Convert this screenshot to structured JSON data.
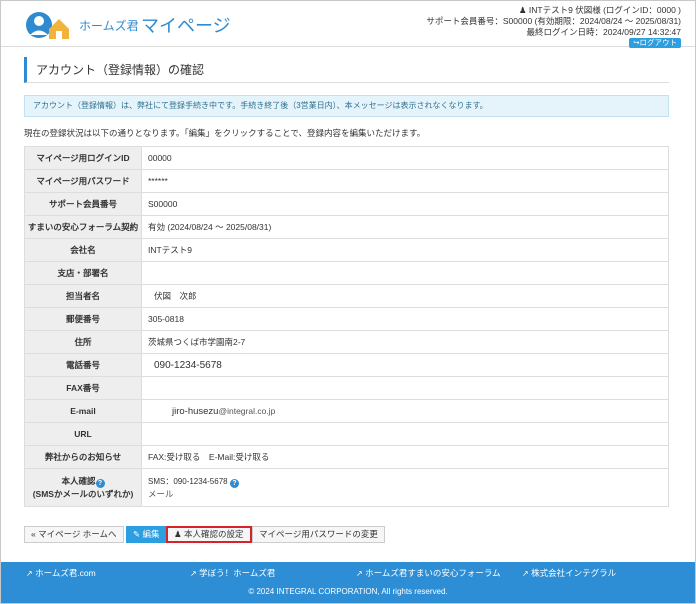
{
  "header": {
    "brand_small": "ホームズ君",
    "brand_large": "マイページ",
    "user_line": "INTテスト9  伏図様 (ログインID：0000  )",
    "member_line": "サポート会員番号：S00000  (有効期限：2024/08/24 ～ 2025/08/31)",
    "last_login": "最終ログイン日時：2024/09/27 14:32:47",
    "logout_label": "ログアウト"
  },
  "page": {
    "title": "アカウント（登録情報）の確認",
    "notice": "アカウント（登録情報）は、弊社にて登録手続き中です。手続き終了後（3営業日内）、本メッセージは表示されなくなります。",
    "intro": "現在の登録状況は以下の通りとなります。「編集」をクリックすることで、登録内容を編集いただけます。"
  },
  "rows": [
    {
      "label": "マイページ用ログインID",
      "value": "00000"
    },
    {
      "label": "マイページ用パスワード",
      "value": "******"
    },
    {
      "label": "サポート会員番号",
      "value": "S00000"
    },
    {
      "label": "すまいの安心フォーラム契約",
      "value": "有効 (2024/08/24 ～ 2025/08/31)"
    },
    {
      "label": "会社名",
      "value": "INTテスト9"
    },
    {
      "label": "支店・部署名",
      "value": ""
    },
    {
      "label": "担当者名",
      "value": "伏図　次郎"
    },
    {
      "label": "郵便番号",
      "value": "305-0818"
    },
    {
      "label": "住所",
      "value": "茨城県つくば市学園南2-7"
    },
    {
      "label": "電話番号",
      "value": "090-1234-5678"
    },
    {
      "label": "FAX番号",
      "value": ""
    },
    {
      "label": "E-mail",
      "value_user": "jiro-husezu",
      "value_domain": "@integral.co.jp"
    },
    {
      "label": "URL",
      "value": ""
    },
    {
      "label": "弊社からのお知らせ",
      "value": "FAX:受け取る　E-Mail:受け取る"
    }
  ],
  "identity": {
    "label_line1": "本人確認",
    "label_line2": "(SMSかメールのいずれか)",
    "sms": "SMS：090-1234-5678",
    "mail": "メール",
    "help": "?"
  },
  "buttons": {
    "home": "« マイページ ホームへ",
    "edit": "編集",
    "identity_setup": "本人確認の設定",
    "password_change": "マイページ用パスワードの変更"
  },
  "footer": {
    "links": [
      "ホームズ君.com",
      "学ぼう！ホームズ君",
      "ホームズ君すまいの安心フォーラム",
      "株式会社インテグラル"
    ],
    "copyright": "© 2024 INTEGRAL CORPORATION, All rights reserved."
  },
  "colors": {
    "accent": "#2e8bd1",
    "footer": "#2d8ed6",
    "highlight_border": "#d8232a"
  }
}
